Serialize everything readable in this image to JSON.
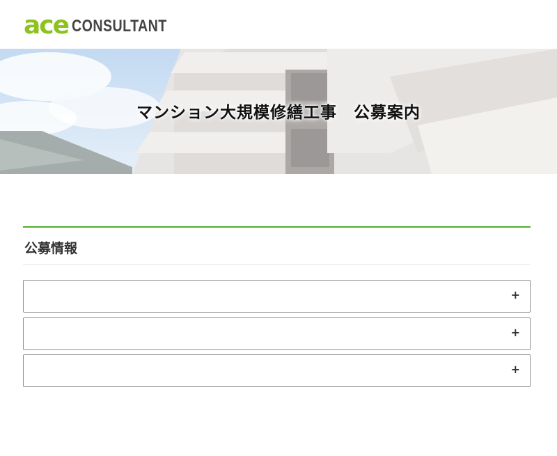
{
  "header": {
    "logo_mark": "ace",
    "logo_text": "CONSULTANT"
  },
  "hero": {
    "title": "マンション大規模修繕工事　公募案内"
  },
  "section": {
    "title": "公募情報"
  },
  "accordion": {
    "items": [
      {
        "icon": "+"
      },
      {
        "icon": "+"
      },
      {
        "icon": "+"
      }
    ]
  },
  "colors": {
    "brand_green": "#8dc21f",
    "section_line": "#4caf2a",
    "text": "#333333"
  }
}
